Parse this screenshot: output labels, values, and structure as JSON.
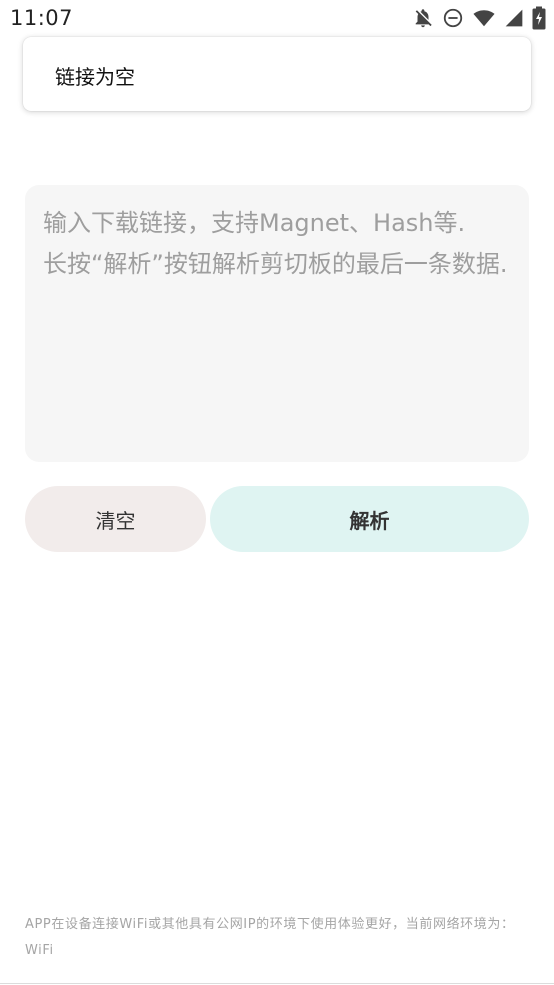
{
  "status_bar": {
    "time": "11:07",
    "icons": [
      "bell-off-icon",
      "do-not-disturb-icon",
      "wifi-icon",
      "signal-icon",
      "battery-charging-icon"
    ]
  },
  "toast": {
    "message": "链接为空"
  },
  "input": {
    "placeholder": "输入下载链接，支持Magnet、Hash等.\n长按“解析”按钮解析剪切板的最后一条数据."
  },
  "buttons": {
    "clear_label": "清空",
    "parse_label": "解析"
  },
  "footer": {
    "note": "APP在设备连接WiFi或其他具有公网IP的环境下使用体验更好，当前网络环境为：WiFi"
  },
  "colors": {
    "input_bg": "#f6f6f6",
    "clear_button_bg": "#f2eceb",
    "parse_button_bg": "#dff4f2",
    "placeholder_text": "#9e9e9e",
    "footer_text": "#a5a5a5"
  }
}
